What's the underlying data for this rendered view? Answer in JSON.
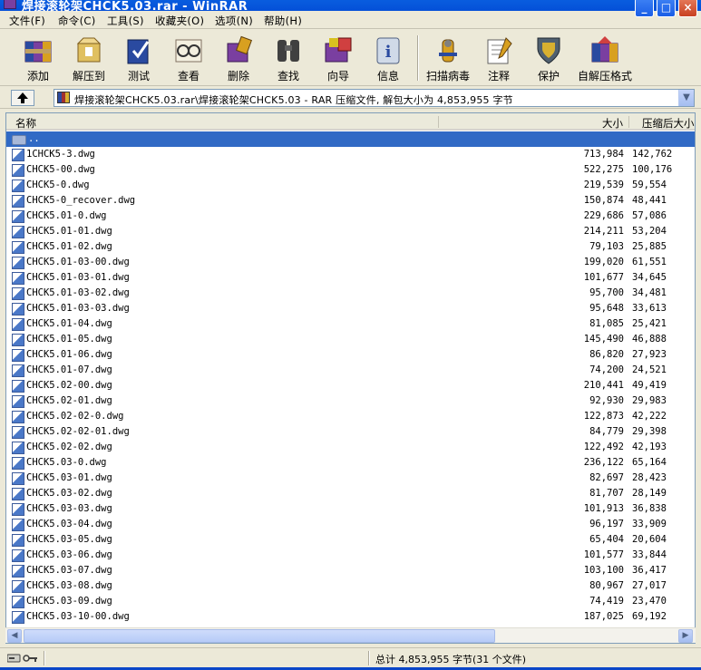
{
  "window": {
    "title": "焊接滚轮架CHCK5.03.rar - WinRAR"
  },
  "menu": [
    "文件(F)",
    "命令(C)",
    "工具(S)",
    "收藏夹(O)",
    "选项(N)",
    "帮助(H)"
  ],
  "toolbar": [
    {
      "label": "添加",
      "icon": "add-icon"
    },
    {
      "label": "解压到",
      "icon": "extract-icon"
    },
    {
      "label": "测试",
      "icon": "test-icon"
    },
    {
      "label": "查看",
      "icon": "view-icon"
    },
    {
      "label": "删除",
      "icon": "delete-icon"
    },
    {
      "label": "查找",
      "icon": "find-icon"
    },
    {
      "label": "向导",
      "icon": "wizard-icon"
    },
    {
      "label": "信息",
      "icon": "info-icon"
    },
    {
      "label": "扫描病毒",
      "icon": "virus-scan-icon"
    },
    {
      "label": "注释",
      "icon": "comment-icon"
    },
    {
      "label": "保护",
      "icon": "protect-icon"
    },
    {
      "label": "自解压格式",
      "icon": "sfx-icon"
    }
  ],
  "address": {
    "path": "焊接滚轮架CHCK5.03.rar\\焊接滚轮架CHCK5.03 - RAR 压缩文件, 解包大小为 4,853,955 字节"
  },
  "columns": {
    "name": "名称",
    "size": "大小",
    "packed": "压缩后大小"
  },
  "parent_row": "..",
  "files": [
    {
      "name": "1CHCK5-3.dwg",
      "size": "713,984",
      "packed": "142,762"
    },
    {
      "name": "CHCK5-00.dwg",
      "size": "522,275",
      "packed": "100,176"
    },
    {
      "name": "CHCK5-0.dwg",
      "size": "219,539",
      "packed": "59,554"
    },
    {
      "name": "CHCK5-0_recover.dwg",
      "size": "150,874",
      "packed": "48,441"
    },
    {
      "name": "CHCK5.01-0.dwg",
      "size": "229,686",
      "packed": "57,086"
    },
    {
      "name": "CHCK5.01-01.dwg",
      "size": "214,211",
      "packed": "53,204"
    },
    {
      "name": "CHCK5.01-02.dwg",
      "size": "79,103",
      "packed": "25,885"
    },
    {
      "name": "CHCK5.01-03-00.dwg",
      "size": "199,020",
      "packed": "61,551"
    },
    {
      "name": "CHCK5.01-03-01.dwg",
      "size": "101,677",
      "packed": "34,645"
    },
    {
      "name": "CHCK5.01-03-02.dwg",
      "size": "95,700",
      "packed": "34,481"
    },
    {
      "name": "CHCK5.01-03-03.dwg",
      "size": "95,648",
      "packed": "33,613"
    },
    {
      "name": "CHCK5.01-04.dwg",
      "size": "81,085",
      "packed": "25,421"
    },
    {
      "name": "CHCK5.01-05.dwg",
      "size": "145,490",
      "packed": "46,888"
    },
    {
      "name": "CHCK5.01-06.dwg",
      "size": "86,820",
      "packed": "27,923"
    },
    {
      "name": "CHCK5.01-07.dwg",
      "size": "74,200",
      "packed": "24,521"
    },
    {
      "name": "CHCK5.02-00.dwg",
      "size": "210,441",
      "packed": "49,419"
    },
    {
      "name": "CHCK5.02-01.dwg",
      "size": "92,930",
      "packed": "29,983"
    },
    {
      "name": "CHCK5.02-02-0.dwg",
      "size": "122,873",
      "packed": "42,222"
    },
    {
      "name": "CHCK5.02-02-01.dwg",
      "size": "84,779",
      "packed": "29,398"
    },
    {
      "name": "CHCK5.02-02.dwg",
      "size": "122,492",
      "packed": "42,193"
    },
    {
      "name": "CHCK5.03-0.dwg",
      "size": "236,122",
      "packed": "65,164"
    },
    {
      "name": "CHCK5.03-01.dwg",
      "size": "82,697",
      "packed": "28,423"
    },
    {
      "name": "CHCK5.03-02.dwg",
      "size": "81,707",
      "packed": "28,149"
    },
    {
      "name": "CHCK5.03-03.dwg",
      "size": "101,913",
      "packed": "36,838"
    },
    {
      "name": "CHCK5.03-04.dwg",
      "size": "96,197",
      "packed": "33,909"
    },
    {
      "name": "CHCK5.03-05.dwg",
      "size": "65,404",
      "packed": "20,604"
    },
    {
      "name": "CHCK5.03-06.dwg",
      "size": "101,577",
      "packed": "33,844"
    },
    {
      "name": "CHCK5.03-07.dwg",
      "size": "103,100",
      "packed": "36,417"
    },
    {
      "name": "CHCK5.03-08.dwg",
      "size": "80,967",
      "packed": "27,017"
    },
    {
      "name": "CHCK5.03-09.dwg",
      "size": "74,419",
      "packed": "23,470"
    },
    {
      "name": "CHCK5.03-10-00.dwg",
      "size": "187,025",
      "packed": "69,192"
    }
  ],
  "status": {
    "summary": "总计 4,853,955 字节(31 个文件)"
  }
}
